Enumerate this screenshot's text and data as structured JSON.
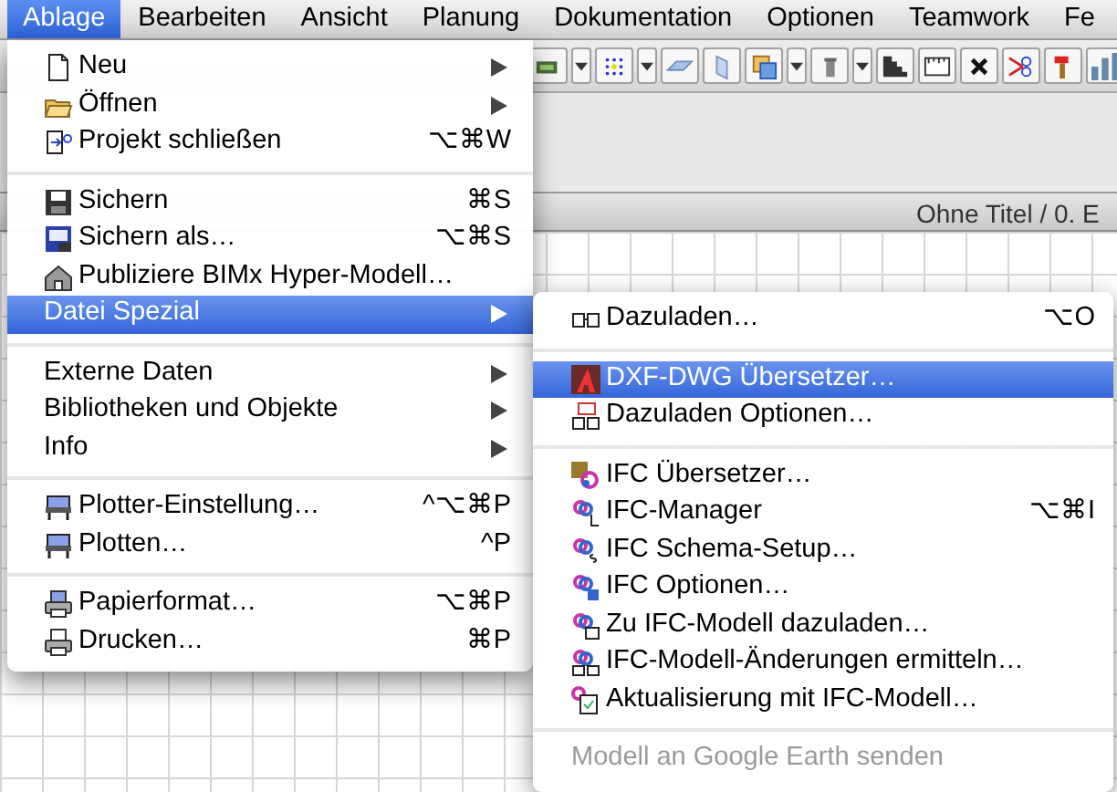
{
  "menubar": [
    {
      "label": "Ablage",
      "selected": true
    },
    {
      "label": "Bearbeiten",
      "selected": false
    },
    {
      "label": "Ansicht",
      "selected": false
    },
    {
      "label": "Planung",
      "selected": false
    },
    {
      "label": "Dokumentation",
      "selected": false
    },
    {
      "label": "Optionen",
      "selected": false
    },
    {
      "label": "Teamwork",
      "selected": false
    },
    {
      "label": "Fe",
      "selected": false
    }
  ],
  "document": {
    "title": "Ohne Titel / 0. E"
  },
  "menu": {
    "items": [
      {
        "kind": "item",
        "label": "Neu",
        "submenu": true,
        "selected": false
      },
      {
        "kind": "item",
        "label": "Öffnen",
        "submenu": true,
        "selected": false
      },
      {
        "kind": "item",
        "label": "Projekt schließen",
        "shortcut": "⌥⌘W",
        "submenu": false,
        "selected": false
      },
      {
        "kind": "separator"
      },
      {
        "kind": "item",
        "label": "Sichern",
        "shortcut": "⌘S",
        "submenu": false,
        "selected": false
      },
      {
        "kind": "item",
        "label": "Sichern als…",
        "shortcut": "⌥⌘S",
        "submenu": false,
        "selected": false
      },
      {
        "kind": "item",
        "label": "Publiziere BIMx Hyper-Modell…",
        "submenu": false,
        "selected": false
      },
      {
        "kind": "item",
        "label": "Datei Spezial",
        "submenu": true,
        "selected": true
      },
      {
        "kind": "separator"
      },
      {
        "kind": "item",
        "label": "Externe Daten",
        "submenu": true,
        "selected": false
      },
      {
        "kind": "item",
        "label": "Bibliotheken und Objekte",
        "submenu": true,
        "selected": false
      },
      {
        "kind": "item",
        "label": "Info",
        "submenu": true,
        "selected": false
      },
      {
        "kind": "separator"
      },
      {
        "kind": "item",
        "label": "Plotter-Einstellung…",
        "shortcut": "^⌥⌘P",
        "submenu": false,
        "selected": false
      },
      {
        "kind": "item",
        "label": "Plotten…",
        "shortcut": "^P",
        "submenu": false,
        "selected": false
      },
      {
        "kind": "separator"
      },
      {
        "kind": "item",
        "label": "Papierformat…",
        "shortcut": "⌥⌘P",
        "submenu": false,
        "selected": false
      },
      {
        "kind": "item",
        "label": "Drucken…",
        "shortcut": "⌘P",
        "submenu": false,
        "selected": false
      }
    ]
  },
  "submenu": {
    "items": [
      {
        "kind": "item",
        "label": "Dazuladen…",
        "shortcut": "⌥O",
        "selected": false,
        "disabled": false
      },
      {
        "kind": "separator"
      },
      {
        "kind": "item",
        "label": "DXF-DWG Übersetzer…",
        "selected": true,
        "disabled": false
      },
      {
        "kind": "item",
        "label": "Dazuladen Optionen…",
        "selected": false,
        "disabled": false
      },
      {
        "kind": "separator"
      },
      {
        "kind": "item",
        "label": "IFC Übersetzer…",
        "selected": false,
        "disabled": false
      },
      {
        "kind": "item",
        "label": "IFC-Manager",
        "shortcut": "⌥⌘I",
        "selected": false,
        "disabled": false
      },
      {
        "kind": "item",
        "label": "IFC Schema-Setup…",
        "selected": false,
        "disabled": false
      },
      {
        "kind": "item",
        "label": "IFC Optionen…",
        "selected": false,
        "disabled": false
      },
      {
        "kind": "item",
        "label": "Zu IFC-Modell dazuladen…",
        "selected": false,
        "disabled": false
      },
      {
        "kind": "item",
        "label": "IFC-Modell-Änderungen ermitteln…",
        "selected": false,
        "disabled": false
      },
      {
        "kind": "item",
        "label": "Aktualisierung mit IFC-Modell…",
        "selected": false,
        "disabled": false
      },
      {
        "kind": "separator"
      },
      {
        "kind": "item",
        "label": "Modell an Google Earth senden",
        "selected": false,
        "disabled": true
      }
    ]
  }
}
